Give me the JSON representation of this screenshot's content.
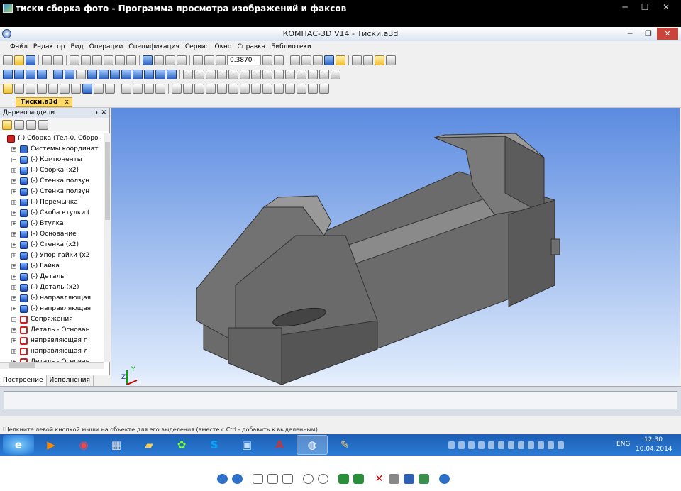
{
  "viewer": {
    "title": "тиски сборка фото - Программа просмотра изображений и факсов",
    "controls": {
      "minimize": "─",
      "maximize": "☐",
      "close": "✕"
    }
  },
  "app": {
    "title": "КОМПАС-3D V14 - Тиски.a3d",
    "controls": {
      "minimize": "─",
      "restore": "❐",
      "close": "✕"
    },
    "menu": [
      "Файл",
      "Редактор",
      "Вид",
      "Операции",
      "Спецификация",
      "Сервис",
      "Окно",
      "Справка",
      "Библиотеки"
    ],
    "scale_value": "0.3870",
    "document_tab": {
      "label": "Тиски.a3d",
      "close": "x"
    }
  },
  "tree_panel": {
    "title": "Дерево модели",
    "pin": "ᵻ",
    "close": "✕",
    "items": [
      {
        "label": "(-) Сборка (Тел-0, Сбороч",
        "level": 0,
        "icon": "root-assembly-icon",
        "exp": ""
      },
      {
        "label": "Системы координат",
        "level": 1,
        "icon": "coord-system-icon",
        "exp": "+"
      },
      {
        "label": "(-) Компоненты",
        "level": 1,
        "icon": "components-icon",
        "exp": "−"
      },
      {
        "label": "(-) Сборка (x2)",
        "level": 2,
        "icon": "assembly-icon",
        "exp": "+"
      },
      {
        "label": "(-) Стенка ползун",
        "level": 2,
        "icon": "part-icon",
        "exp": "+"
      },
      {
        "label": "(-) Стенка ползун",
        "level": 2,
        "icon": "part-icon",
        "exp": "+"
      },
      {
        "label": "(-) Перемычка",
        "level": 2,
        "icon": "part-icon",
        "exp": "+"
      },
      {
        "label": "(-) Скоба втулки (",
        "level": 2,
        "icon": "part-icon",
        "exp": "+"
      },
      {
        "label": "(-) Втулка",
        "level": 2,
        "icon": "part-icon",
        "exp": "+"
      },
      {
        "label": "(-) Основание",
        "level": 2,
        "icon": "part-icon",
        "exp": "+"
      },
      {
        "label": "(-) Стенка (x2)",
        "level": 2,
        "icon": "part-icon",
        "exp": "+"
      },
      {
        "label": "(-) Упор гайки (x2",
        "level": 2,
        "icon": "part-icon",
        "exp": "+"
      },
      {
        "label": "(-) Гайка",
        "level": 2,
        "icon": "part-icon",
        "exp": "+"
      },
      {
        "label": "(-) Деталь",
        "level": 2,
        "icon": "part-icon",
        "exp": "+"
      },
      {
        "label": "(-) Деталь (x2)",
        "level": 2,
        "icon": "part-icon",
        "exp": "+"
      },
      {
        "label": "(-) направляющая",
        "level": 2,
        "icon": "part-icon",
        "exp": "+"
      },
      {
        "label": "(-) направляющая",
        "level": 2,
        "icon": "part-icon",
        "exp": "+"
      },
      {
        "label": "Сопряжения",
        "level": 1,
        "icon": "mates-icon",
        "exp": "−"
      },
      {
        "label": "Деталь - Основан",
        "level": 2,
        "icon": "mate-icon",
        "exp": "+"
      },
      {
        "label": "направляющая п",
        "level": 2,
        "icon": "mate-icon",
        "exp": "+"
      },
      {
        "label": "направляющая л",
        "level": 2,
        "icon": "mate-icon",
        "exp": "+"
      },
      {
        "label": "Деталь - Основан",
        "level": 2,
        "icon": "mate-icon",
        "exp": "+"
      }
    ],
    "tabs": [
      "Построение",
      "Исполнения"
    ]
  },
  "axis_labels": {
    "x": "X",
    "y": "Y",
    "z": "Z"
  },
  "status": {
    "hint": "Щелкните левой кнопкой мыши на объекте для его выделения (вместе с Ctrl - добавить к выделенным)"
  },
  "taskbar": {
    "apps": [
      "ie-icon",
      "media-player-icon",
      "chrome-icon",
      "calculator-icon",
      "explorer-icon",
      "icq-icon",
      "skype-icon",
      "photo-viewer-icon",
      "access-icon",
      "kompas-icon",
      "paint-icon"
    ],
    "lang": "ENG",
    "time": "12:30",
    "date": "10.04.2014"
  },
  "colors": {
    "accent": "#2a7bd6",
    "viewport_top": "#5b8be0",
    "viewport_bottom": "#eaf1fc",
    "model_gray": "#6b6b6b"
  }
}
